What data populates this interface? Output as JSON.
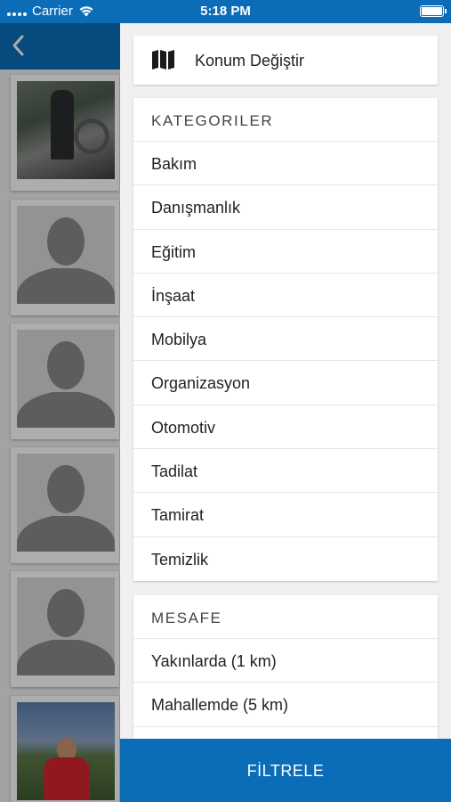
{
  "status_bar": {
    "carrier": "Carrier",
    "time": "5:18 PM"
  },
  "location": {
    "label": "Konum Değiştir",
    "icon": "map-icon"
  },
  "categories": {
    "heading": "KATEGORILER",
    "items": [
      "Bakım",
      "Danışmanlık",
      "Eğitim",
      "İnşaat",
      "Mobilya",
      "Organizasyon",
      "Otomotiv",
      "Tadilat",
      "Tamirat",
      "Temizlik"
    ]
  },
  "distance": {
    "heading": "MESAFE",
    "items": [
      "Yakınlarda (1 km)",
      "Mahallemde (5 km)"
    ]
  },
  "filter_button": {
    "label": "FİLTRELE"
  },
  "colors": {
    "brand_blue": "#0b6db8",
    "background": "#f0f0f0"
  }
}
